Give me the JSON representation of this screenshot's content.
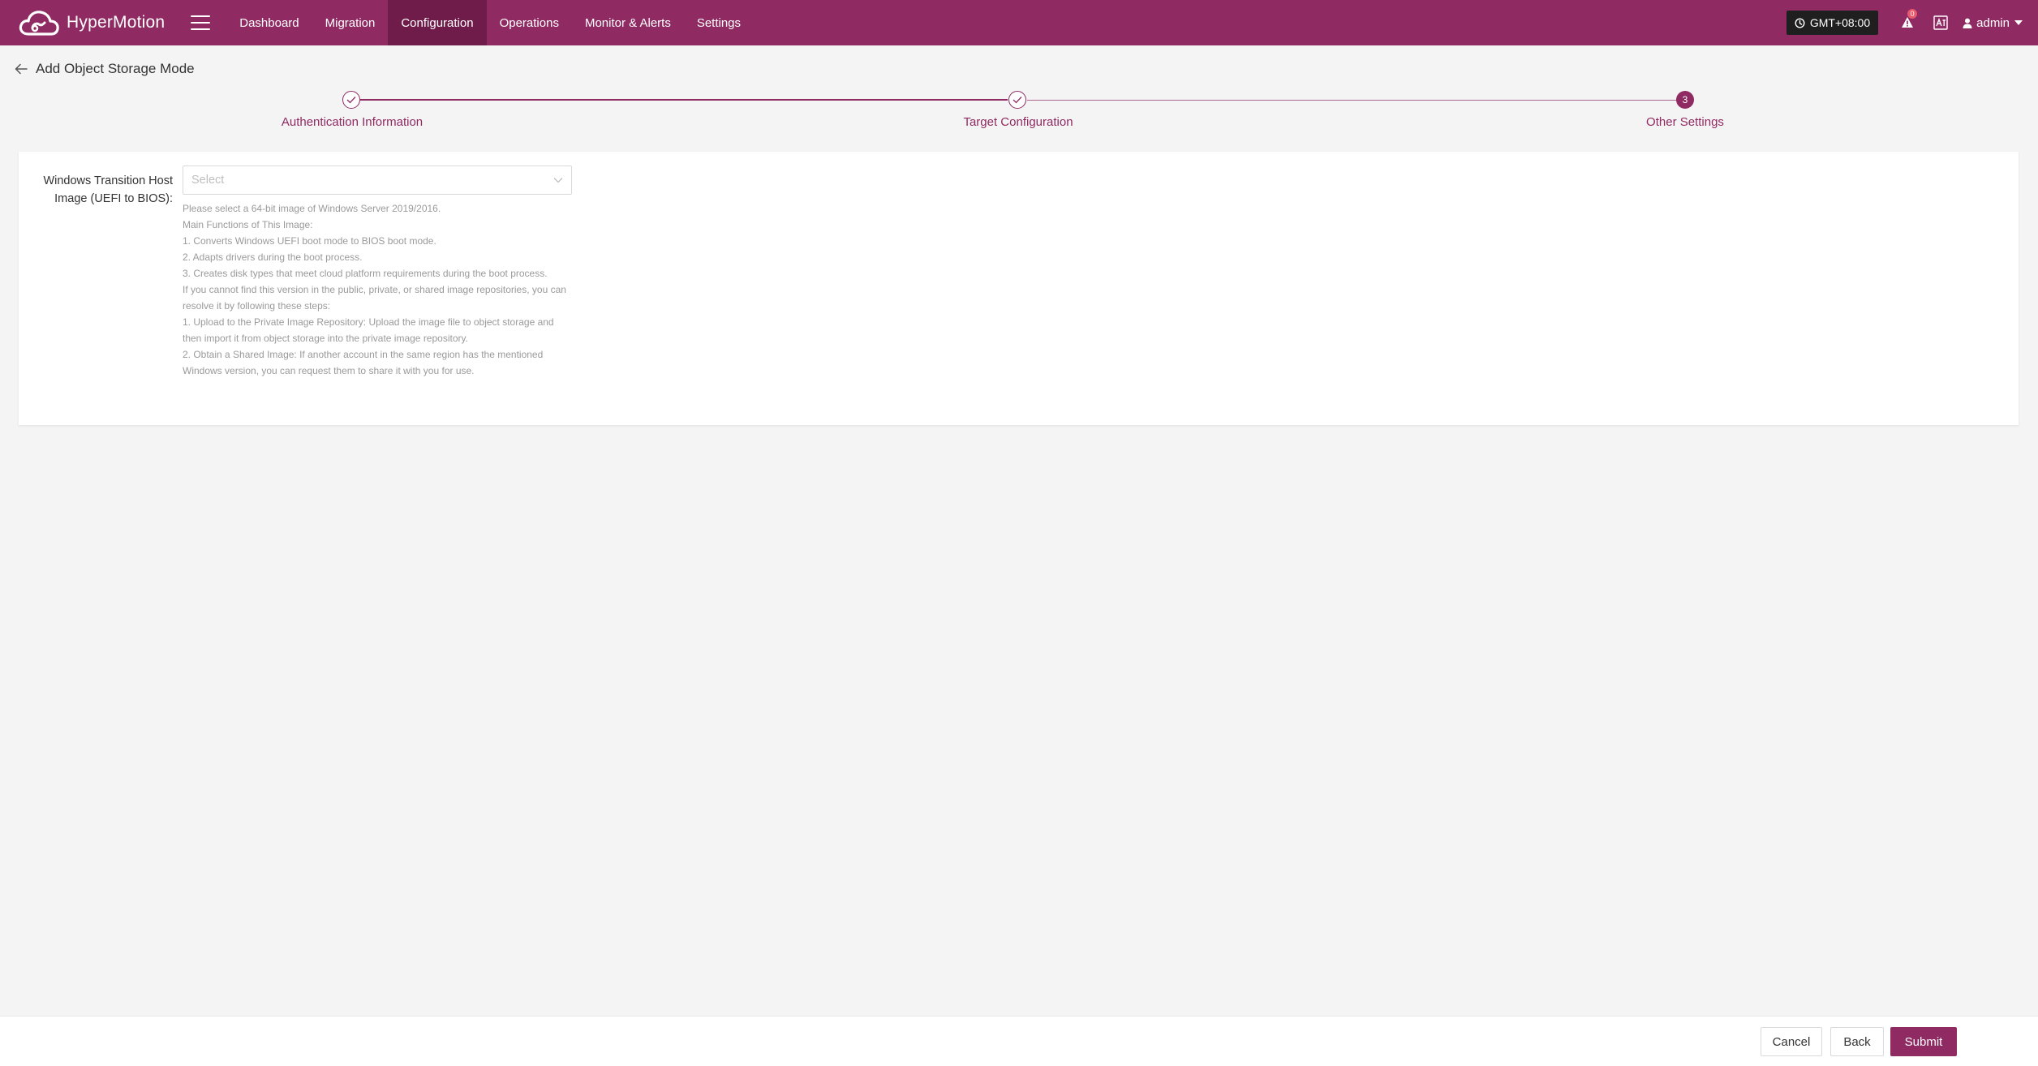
{
  "app": {
    "brand": "HyperMotion"
  },
  "nav": {
    "items": [
      {
        "label": "Dashboard"
      },
      {
        "label": "Migration"
      },
      {
        "label": "Configuration"
      },
      {
        "label": "Operations"
      },
      {
        "label": "Monitor & Alerts"
      },
      {
        "label": "Settings"
      }
    ],
    "active": "Configuration"
  },
  "header": {
    "timezone": "GMT+08:00",
    "notification_count": "0",
    "user": "admin"
  },
  "page": {
    "title": "Add Object Storage Mode"
  },
  "steps": [
    {
      "label": "Authentication Information",
      "status": "done"
    },
    {
      "label": "Target Configuration",
      "status": "done"
    },
    {
      "label": "Other Settings",
      "status": "current",
      "number": "3"
    }
  ],
  "form": {
    "field_label_line1": "Windows Transition Host",
    "field_label_line2": "Image (UEFI to BIOS):",
    "select_placeholder": "Select",
    "help_lines": [
      "Please select a 64-bit image of Windows Server 2019/2016.",
      "Main Functions of This Image:",
      "1. Converts Windows UEFI boot mode to BIOS boot mode.",
      "2. Adapts drivers during the boot process.",
      "3. Creates disk types that meet cloud platform requirements during the boot process.",
      "If you cannot find this version in the public, private, or shared image repositories, you can",
      "resolve it by following these steps:",
      "1. Upload to the Private Image Repository: Upload the image file to object storage and",
      "then import it from object storage into the private image repository.",
      "2. Obtain a Shared Image: If another account in the same region has the mentioned",
      "Windows version, you can request them to share it with you for use."
    ]
  },
  "footer": {
    "cancel": "Cancel",
    "back": "Back",
    "submit": "Submit"
  },
  "colors": {
    "brand": "#8f2a62",
    "brand_dark": "#6f1c4a",
    "background": "#f4f4f4"
  }
}
